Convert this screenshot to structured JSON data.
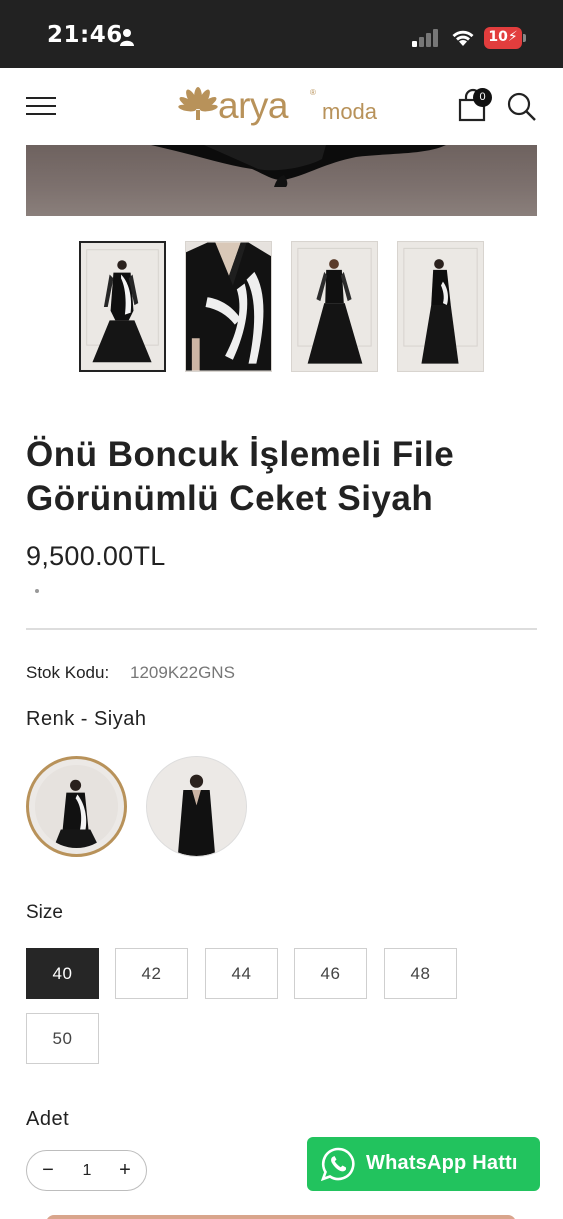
{
  "status_bar": {
    "time": "21:46",
    "battery": "10",
    "battery_color": "#e23d3d"
  },
  "header": {
    "logo_text": "arya",
    "logo_suffix": "moda",
    "logo_reg": "®",
    "cart_count": "0",
    "brand_color": "#b8925a"
  },
  "gallery": {
    "thumbnails": [
      {
        "label": "Ön görünüm",
        "active": true
      },
      {
        "label": "Detay",
        "active": false
      },
      {
        "label": "Arka görünüm",
        "active": false
      },
      {
        "label": "Yan görünüm",
        "active": false
      }
    ]
  },
  "product": {
    "title": "Önü Boncuk İşlemeli File Görünümlü Ceket Siyah",
    "price": "9,500.00TL",
    "stock_label": "Stok Kodu:",
    "stock_value": "1209K22GNS"
  },
  "color": {
    "label": "Renk - Siyah"
  },
  "size": {
    "label": "Size",
    "options": [
      "40",
      "42",
      "44",
      "46",
      "48",
      "50"
    ],
    "selected": "40"
  },
  "quantity": {
    "label": "Adet",
    "minus": "−",
    "value": "1",
    "plus": "+"
  },
  "whatsapp": {
    "label": "WhatsApp Hattı",
    "color": "#22c35e"
  },
  "icons": [
    "person-icon",
    "signal-icon",
    "wifi-icon",
    "battery-icon",
    "menu-icon",
    "cart-icon",
    "search-icon",
    "whatsapp-icon"
  ]
}
